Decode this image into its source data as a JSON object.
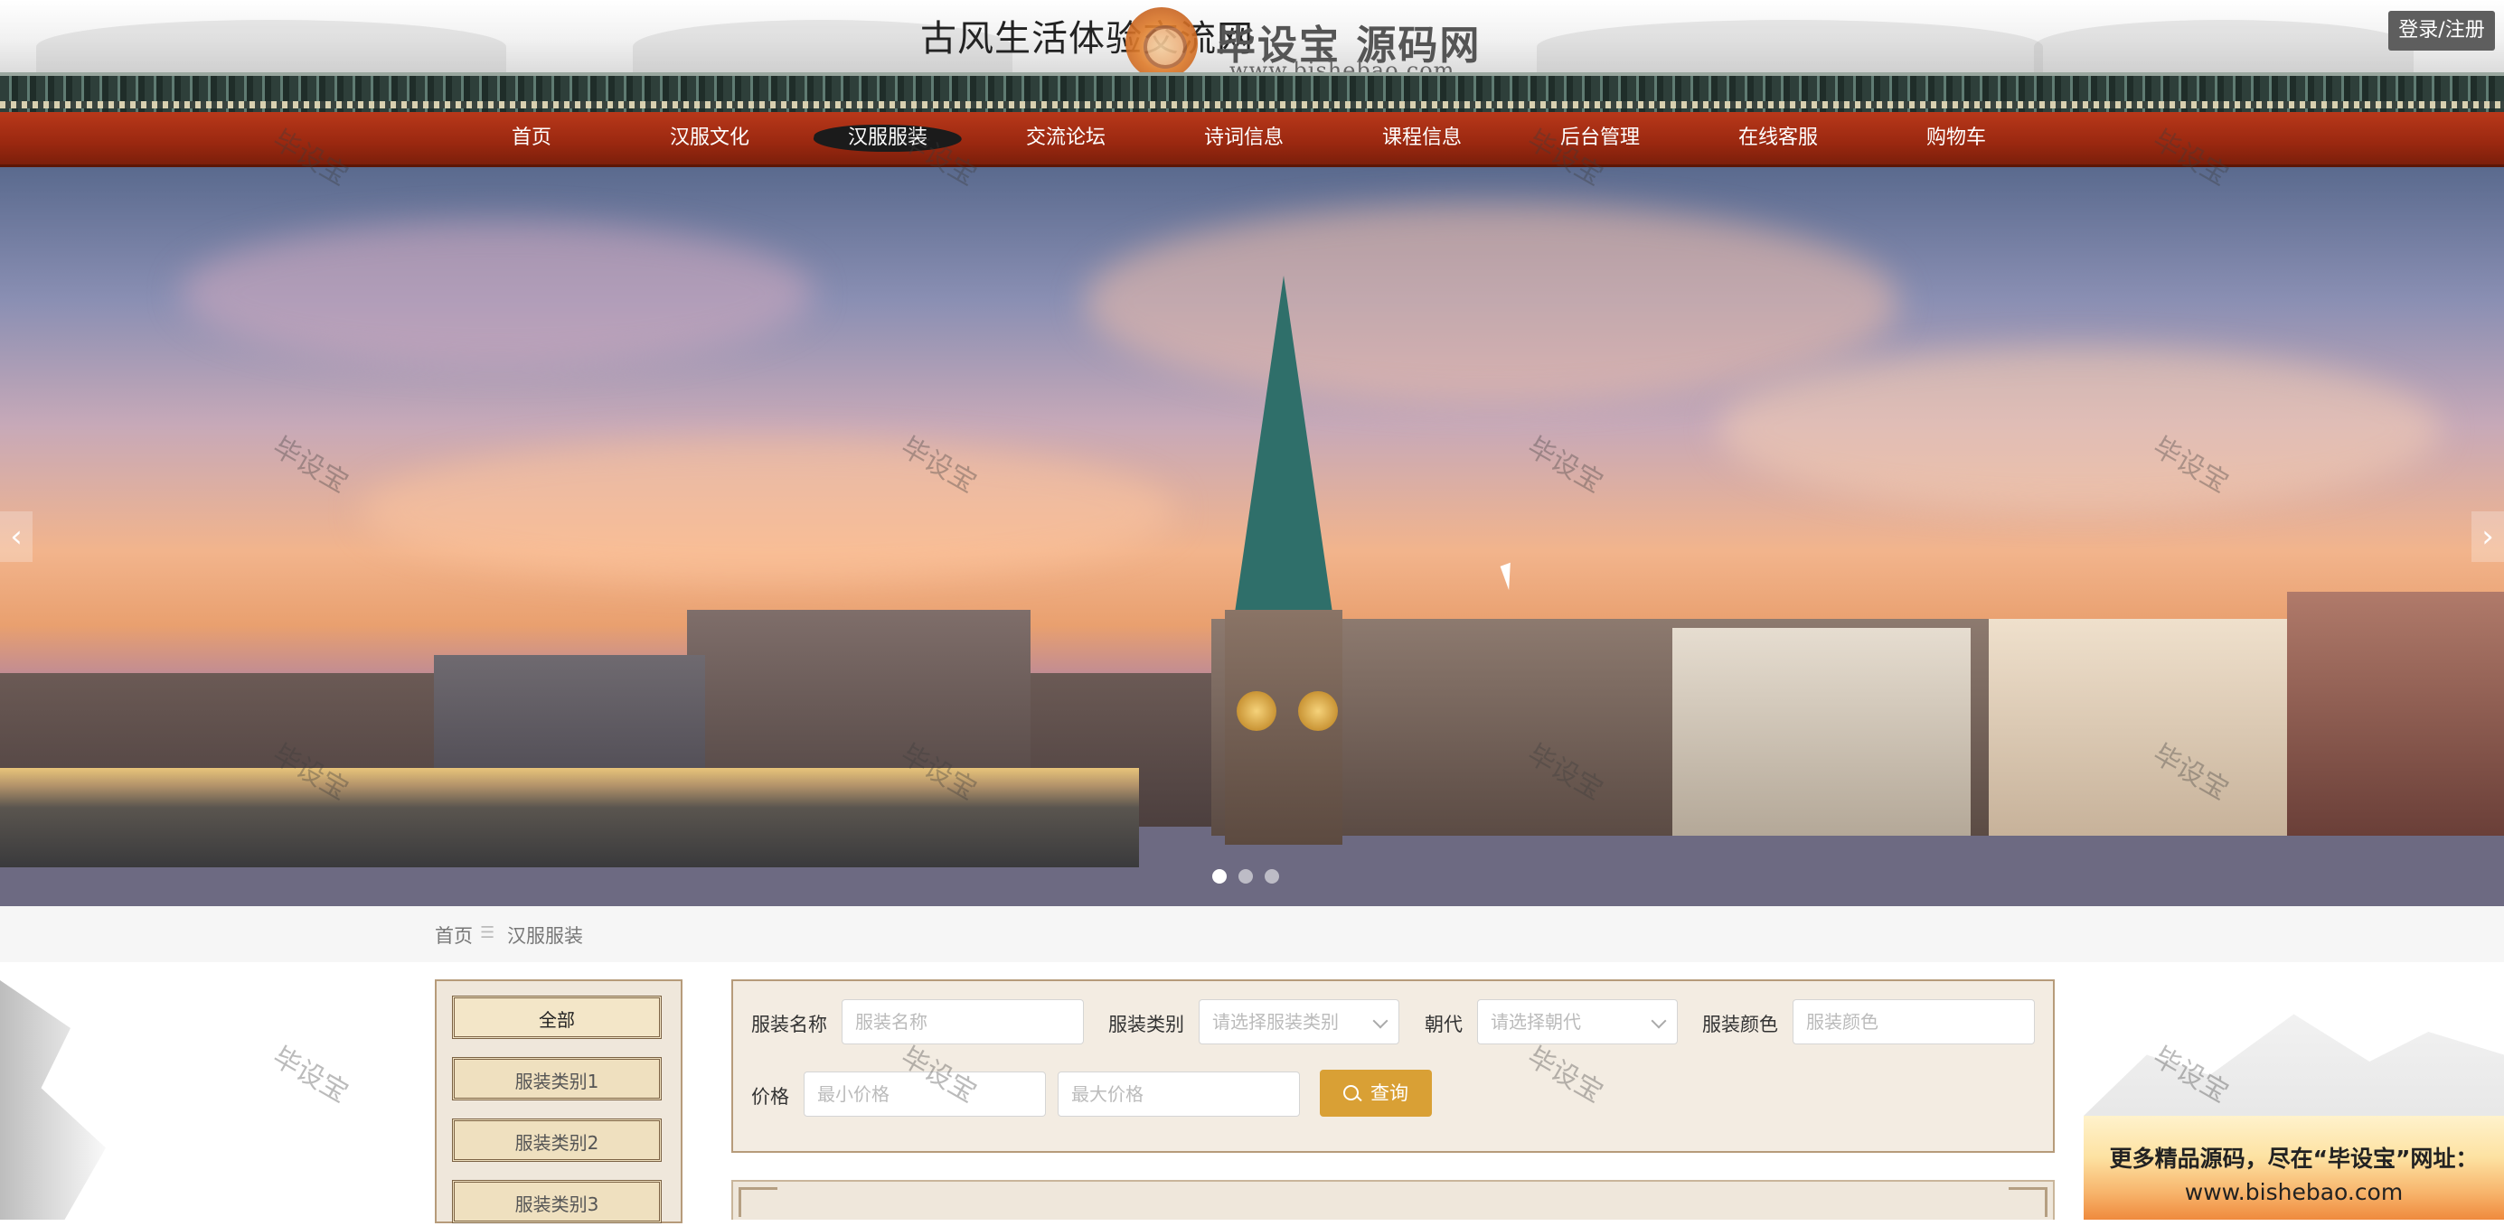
{
  "header": {
    "site_title": "古风生活体验交流网",
    "brand_name": "毕设宝 源码网",
    "brand_url": "www.bishebao.com",
    "login_label": "登录/注册"
  },
  "nav": {
    "items": [
      {
        "label": "首页"
      },
      {
        "label": "汉服文化"
      },
      {
        "label": "汉服服装",
        "active": true
      },
      {
        "label": "交流论坛"
      },
      {
        "label": "诗词信息"
      },
      {
        "label": "课程信息"
      },
      {
        "label": "后台管理"
      },
      {
        "label": "在线客服"
      },
      {
        "label": "购物车"
      }
    ]
  },
  "banner": {
    "prev_icon": "‹",
    "next_icon": "›",
    "slides": 3,
    "active_slide": 1
  },
  "breadcrumb": {
    "home": "首页",
    "separator": "☰",
    "current": "汉服服装"
  },
  "categories": {
    "items": [
      {
        "label": "全部",
        "active": true
      },
      {
        "label": "服装类别1"
      },
      {
        "label": "服装类别2"
      },
      {
        "label": "服装类别3"
      }
    ]
  },
  "search": {
    "name_label": "服装名称",
    "name_placeholder": "服装名称",
    "type_label": "服装类别",
    "type_placeholder": "请选择服装类别",
    "dynasty_label": "朝代",
    "dynasty_placeholder": "请选择朝代",
    "color_label": "服装颜色",
    "color_placeholder": "服装颜色",
    "price_label": "价格",
    "min_price_placeholder": "最小价格",
    "max_price_placeholder": "最大价格",
    "query_label": "查询"
  },
  "watermark": {
    "text": "毕设宝"
  },
  "promo": {
    "line1": "更多精品源码，尽在“毕设宝”网址：",
    "line2": "www.bishebao.com"
  },
  "colors": {
    "nav_red": "#9a2810",
    "query_gold": "#d9a035",
    "panel_beige": "#efe7db",
    "login_grey": "#5e5e5e"
  }
}
